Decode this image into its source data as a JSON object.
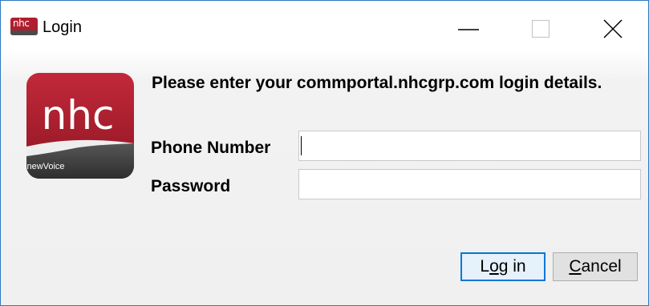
{
  "window": {
    "title": "Login",
    "app_icon_text": "nhc",
    "controls": {
      "minimize": "minimize-icon",
      "maximize": "maximize-icon",
      "close": "close-icon"
    },
    "border_color": "#2b79c2"
  },
  "logo": {
    "brand": "nhc",
    "tagline": "newVoice",
    "color": "#b01e2e"
  },
  "dialog": {
    "prompt": "Please enter your commportal.nhcgrp.com login details.",
    "phone_label": "Phone Number",
    "phone_value": "",
    "password_label": "Password",
    "password_value": ""
  },
  "buttons": {
    "login": {
      "before": "L",
      "accel": "o",
      "after": "g in"
    },
    "cancel": {
      "before": "",
      "accel": "C",
      "after": "ancel"
    },
    "focus_color": "#0078d7"
  }
}
